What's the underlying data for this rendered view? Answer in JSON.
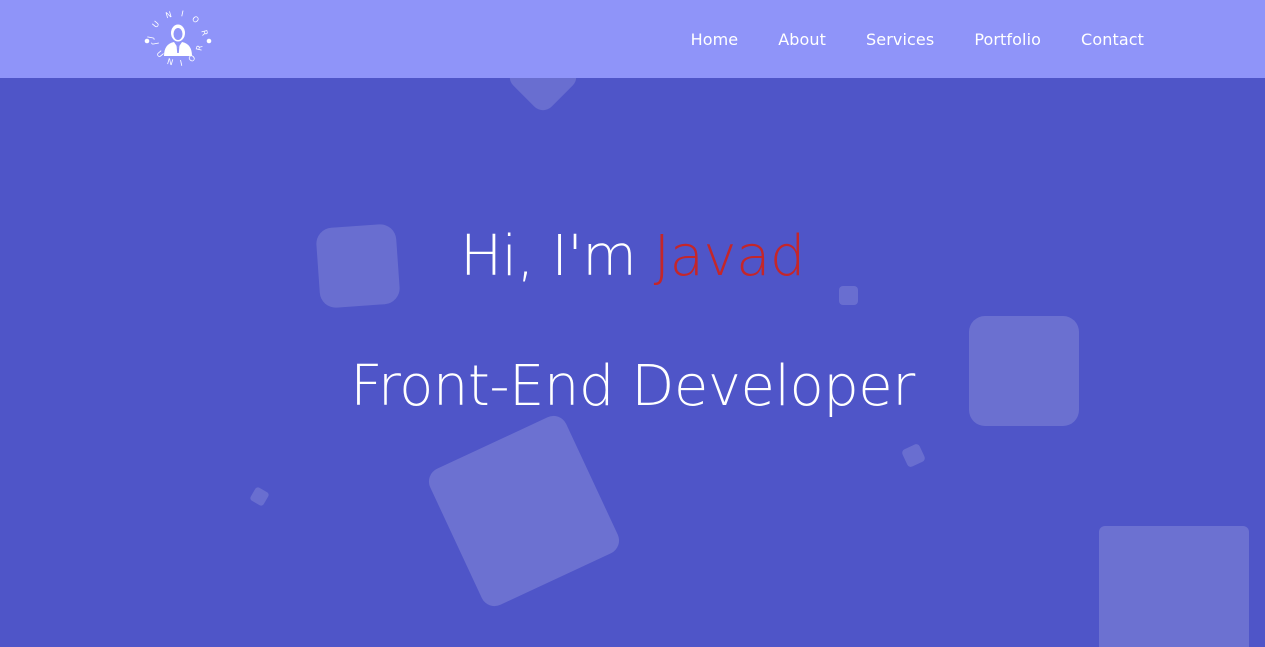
{
  "brand": {
    "logo_text": "J U N I O R",
    "logo_icon": "person-silhouette-icon"
  },
  "nav": {
    "items": [
      {
        "label": "Home"
      },
      {
        "label": "About"
      },
      {
        "label": "Services"
      },
      {
        "label": "Portfolio"
      },
      {
        "label": "Contact"
      }
    ]
  },
  "hero": {
    "greeting": "Hi, I'm ",
    "name": "Javad",
    "role": "Front-End Developer"
  },
  "colors": {
    "navbar_bg": "#8f94f9",
    "hero_bg": "#4f55c8",
    "accent": "#c4262a",
    "text": "#ffffff"
  }
}
